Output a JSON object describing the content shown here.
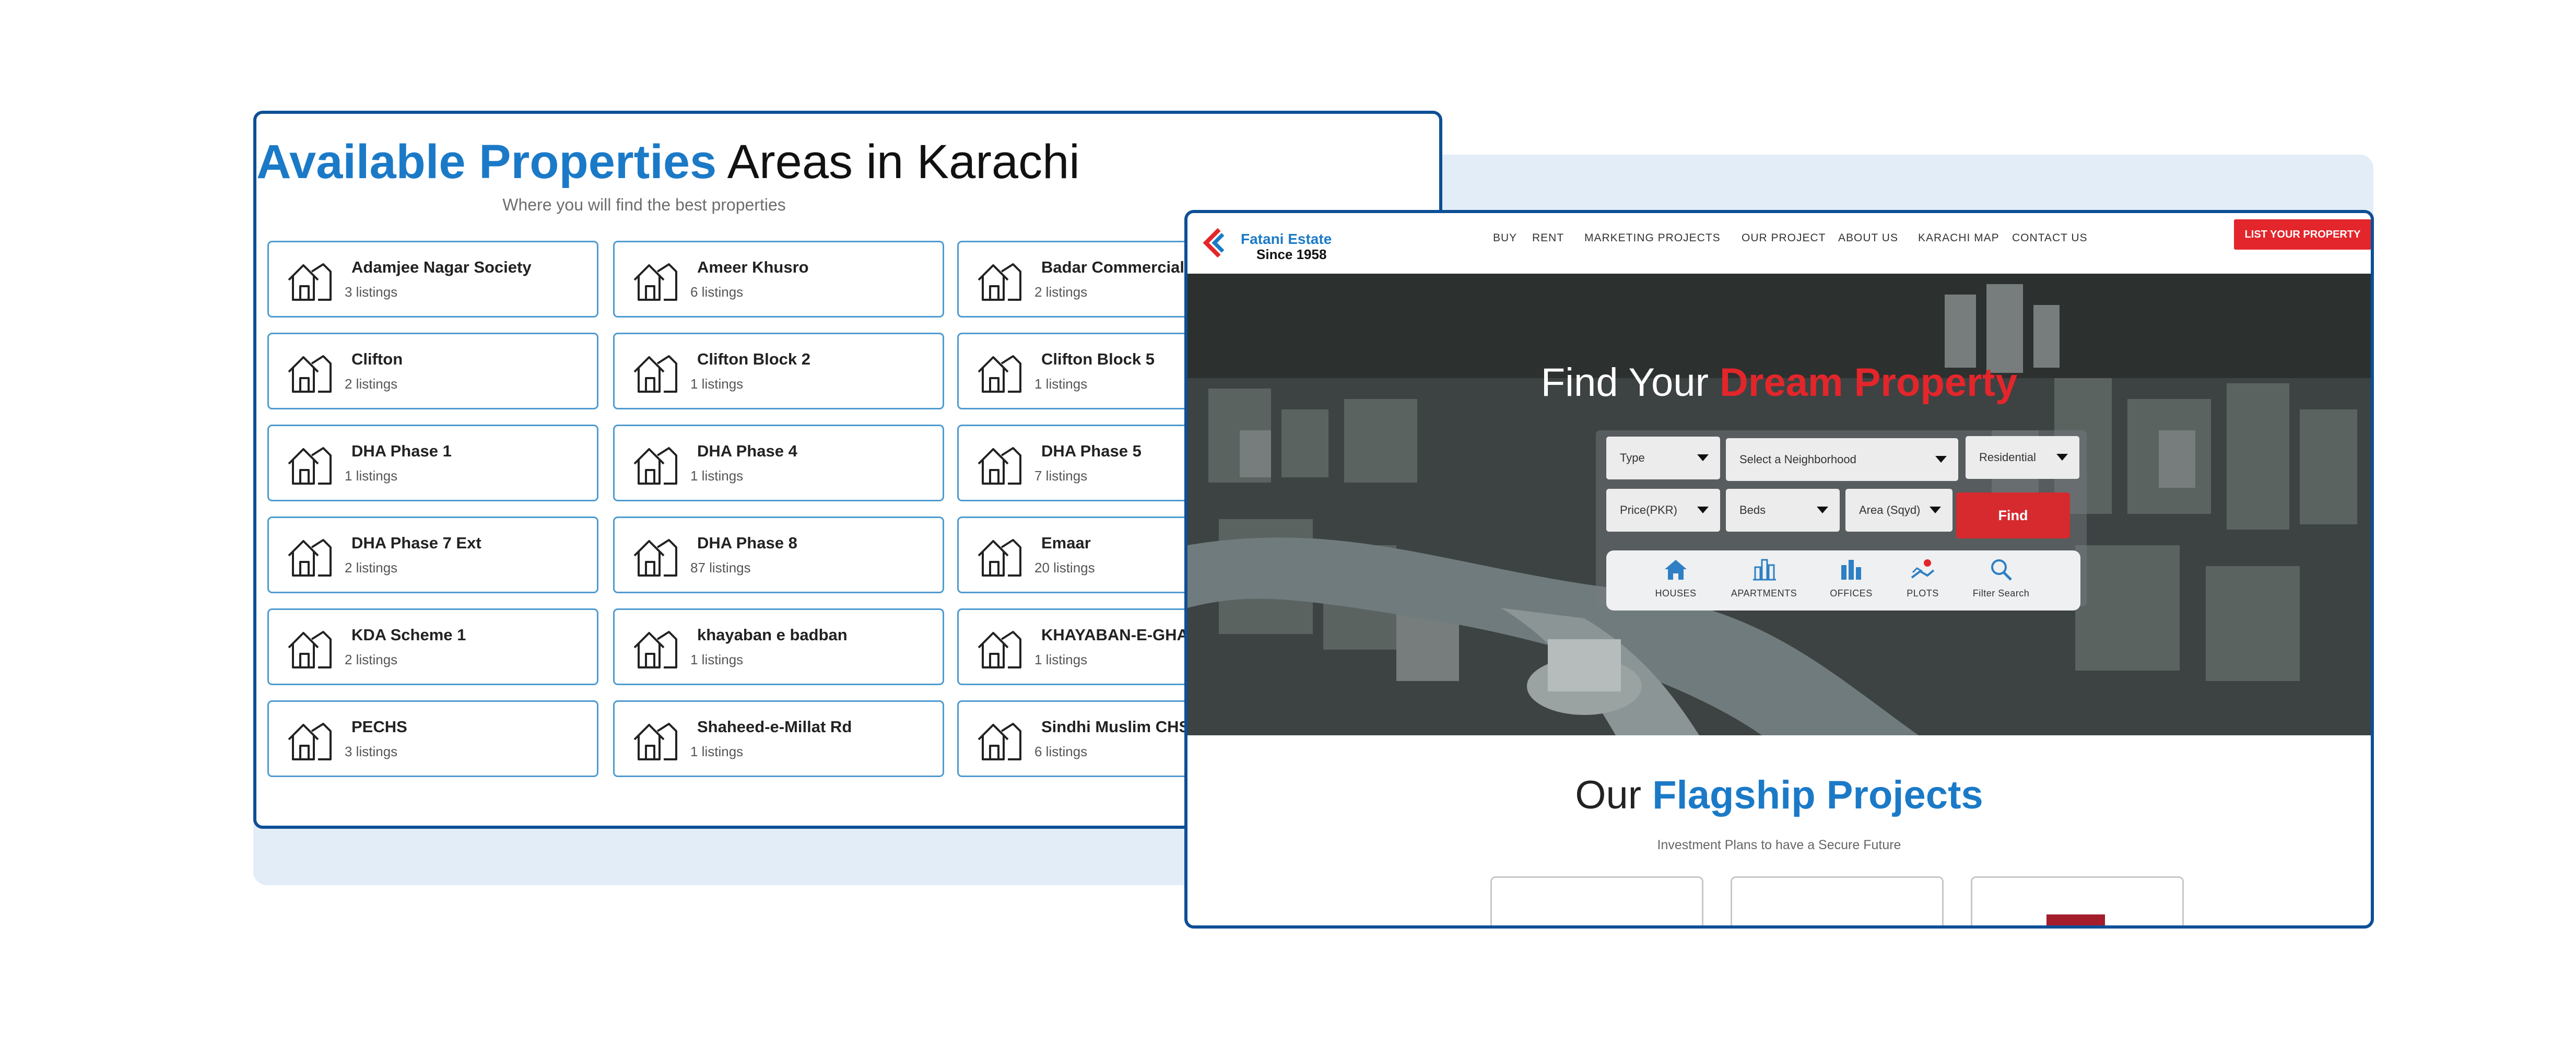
{
  "areas_page": {
    "title_highlight": "Available Properties",
    "title_rest": " Areas in Karachi",
    "subtitle": "Where you will find the best properties",
    "areas": [
      {
        "name": "Adamjee Nagar Society",
        "count": "3 listings"
      },
      {
        "name": "Ameer Khusro",
        "count": "6 listings"
      },
      {
        "name": "Badar Commercial",
        "count": "2 listings"
      },
      {
        "name": "Clifton",
        "count": "2 listings"
      },
      {
        "name": "Clifton Block 2",
        "count": "1 listings"
      },
      {
        "name": "Clifton Block 5",
        "count": "1 listings"
      },
      {
        "name": "DHA Phase 1",
        "count": "1 listings"
      },
      {
        "name": "DHA Phase 4",
        "count": "1 listings"
      },
      {
        "name": "DHA Phase 5",
        "count": "7 listings"
      },
      {
        "name": "DHA Phase 7 Ext",
        "count": "2 listings"
      },
      {
        "name": "DHA Phase 8",
        "count": "87 listings"
      },
      {
        "name": "Emaar",
        "count": "20 listings"
      },
      {
        "name": "KDA Scheme 1",
        "count": "2 listings"
      },
      {
        "name": "khayaban e badban",
        "count": "1 listings"
      },
      {
        "name": "KHAYABAN-E-GHAZ",
        "count": "1 listings"
      },
      {
        "name": "PECHS",
        "count": "3 listings"
      },
      {
        "name": "Shaheed-e-Millat Rd",
        "count": "1 listings"
      },
      {
        "name": "Sindhi Muslim CHS (",
        "count": "6 listings"
      }
    ]
  },
  "site": {
    "logo": {
      "line1": "Fatani Estate",
      "line2": "Since 1958"
    },
    "nav": [
      "BUY",
      "RENT",
      "MARKETING PROJECTS",
      "OUR PROJECT",
      "ABOUT US",
      "KARACHI MAP",
      "CONTACT US"
    ],
    "cta_label": "LIST YOUR PROPERTY",
    "hero": {
      "title_plain": "Find Your ",
      "title_highlight": "Dream Property"
    },
    "search": {
      "type": "Type",
      "neighborhood": "Select a Neighborhood",
      "residential": "Residential",
      "price": "Price(PKR)",
      "beds": "Beds",
      "area": "Area (Sqyd)",
      "find_label": "Find"
    },
    "categories": [
      {
        "label": "HOUSES",
        "icon": "house-icon"
      },
      {
        "label": "APARTMENTS",
        "icon": "apartment-icon"
      },
      {
        "label": "OFFICES",
        "icon": "office-icon"
      },
      {
        "label": "PLOTS",
        "icon": "plot-icon"
      },
      {
        "label": "Filter Search",
        "icon": "search-icon"
      }
    ],
    "flagship": {
      "title_plain": "Our ",
      "title_highlight": "Flagship Projects",
      "subtitle": "Investment Plans to have a Secure Future"
    }
  },
  "colors": {
    "accent_blue": "#1b7ac7",
    "accent_red": "#e3262b",
    "frame_blue": "#0d4f96",
    "backdrop": "#e3edf8"
  }
}
